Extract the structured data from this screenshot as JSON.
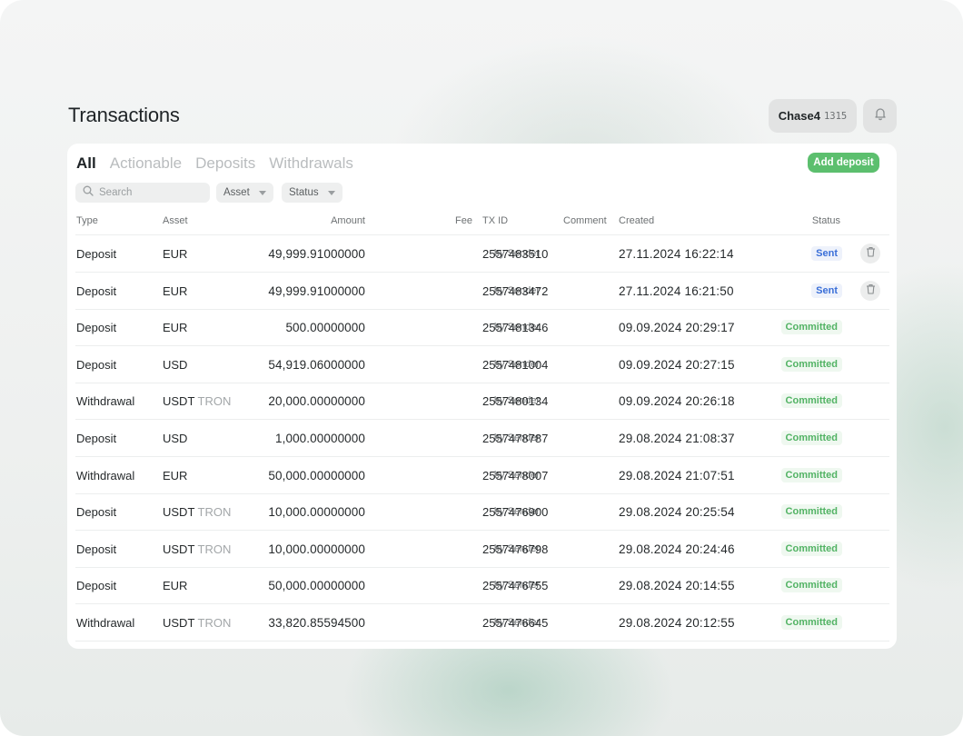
{
  "header": {
    "title": "Transactions",
    "account_name": "Chase4",
    "account_id": "1315"
  },
  "tabs": [
    {
      "label": "All",
      "active": true
    },
    {
      "label": "Actionable",
      "active": false
    },
    {
      "label": "Deposits",
      "active": false
    },
    {
      "label": "Withdrawals",
      "active": false
    }
  ],
  "toolbar": {
    "add_deposit_label": "Add deposit",
    "search_placeholder": "Search",
    "asset_filter_label": "Asset",
    "status_filter_label": "Status"
  },
  "columns": {
    "type": "Type",
    "asset": "Asset",
    "amount": "Amount",
    "fee": "Fee",
    "txid": "TX ID",
    "comment": "Comment",
    "created": "Created",
    "status": "Status"
  },
  "colors": {
    "accent_green": "#5cbf6e",
    "sent_blue": "#3a6fd8",
    "committed_green": "#52b364"
  },
  "rows": [
    {
      "type": "Deposit",
      "asset": "EUR",
      "network": "",
      "amount": "49,999.91000000",
      "fee": "by Sender",
      "txid": "2557483510",
      "comment": "",
      "created": "27.11.2024 16:22:14",
      "status": "Sent",
      "status_kind": "sent",
      "deletable": true
    },
    {
      "type": "Deposit",
      "asset": "EUR",
      "network": "",
      "amount": "49,999.91000000",
      "fee": "by Sender",
      "txid": "2557483472",
      "comment": "",
      "created": "27.11.2024 16:21:50",
      "status": "Sent",
      "status_kind": "sent",
      "deletable": true
    },
    {
      "type": "Deposit",
      "asset": "EUR",
      "network": "",
      "amount": "500.00000000",
      "fee": "by Sender",
      "txid": "2557481346",
      "comment": "",
      "created": "09.09.2024 20:29:17",
      "status": "Committed",
      "status_kind": "committed",
      "deletable": false
    },
    {
      "type": "Deposit",
      "asset": "USD",
      "network": "",
      "amount": "54,919.06000000",
      "fee": "by Sender",
      "txid": "2557481004",
      "comment": "",
      "created": "09.09.2024 20:27:15",
      "status": "Committed",
      "status_kind": "committed",
      "deletable": false
    },
    {
      "type": "Withdrawal",
      "asset": "USDT",
      "network": "TRON",
      "amount": "20,000.00000000",
      "fee": "by Sender",
      "txid": "2557480134",
      "comment": "",
      "created": "09.09.2024 20:26:18",
      "status": "Committed",
      "status_kind": "committed",
      "deletable": false
    },
    {
      "type": "Deposit",
      "asset": "USD",
      "network": "",
      "amount": "1,000.00000000",
      "fee": "by Sender",
      "txid": "2557478787",
      "comment": "",
      "created": "29.08.2024 21:08:37",
      "status": "Committed",
      "status_kind": "committed",
      "deletable": false
    },
    {
      "type": "Withdrawal",
      "asset": "EUR",
      "network": "",
      "amount": "50,000.00000000",
      "fee": "by Sender",
      "txid": "2557478007",
      "comment": "",
      "created": "29.08.2024 21:07:51",
      "status": "Committed",
      "status_kind": "committed",
      "deletable": false
    },
    {
      "type": "Deposit",
      "asset": "USDT",
      "network": "TRON",
      "amount": "10,000.00000000",
      "fee": "by Sender",
      "txid": "2557476900",
      "comment": "",
      "created": "29.08.2024 20:25:54",
      "status": "Committed",
      "status_kind": "committed",
      "deletable": false
    },
    {
      "type": "Deposit",
      "asset": "USDT",
      "network": "TRON",
      "amount": "10,000.00000000",
      "fee": "by Sender",
      "txid": "2557476798",
      "comment": "",
      "created": "29.08.2024 20:24:46",
      "status": "Committed",
      "status_kind": "committed",
      "deletable": false
    },
    {
      "type": "Deposit",
      "asset": "EUR",
      "network": "",
      "amount": "50,000.00000000",
      "fee": "by Sender",
      "txid": "2557476755",
      "comment": "",
      "created": "29.08.2024 20:14:55",
      "status": "Committed",
      "status_kind": "committed",
      "deletable": false
    },
    {
      "type": "Withdrawal",
      "asset": "USDT",
      "network": "TRON",
      "amount": "33,820.85594500",
      "fee": "by Sender",
      "txid": "2557476645",
      "comment": "",
      "created": "29.08.2024 20:12:55",
      "status": "Committed",
      "status_kind": "committed",
      "deletable": false
    }
  ]
}
